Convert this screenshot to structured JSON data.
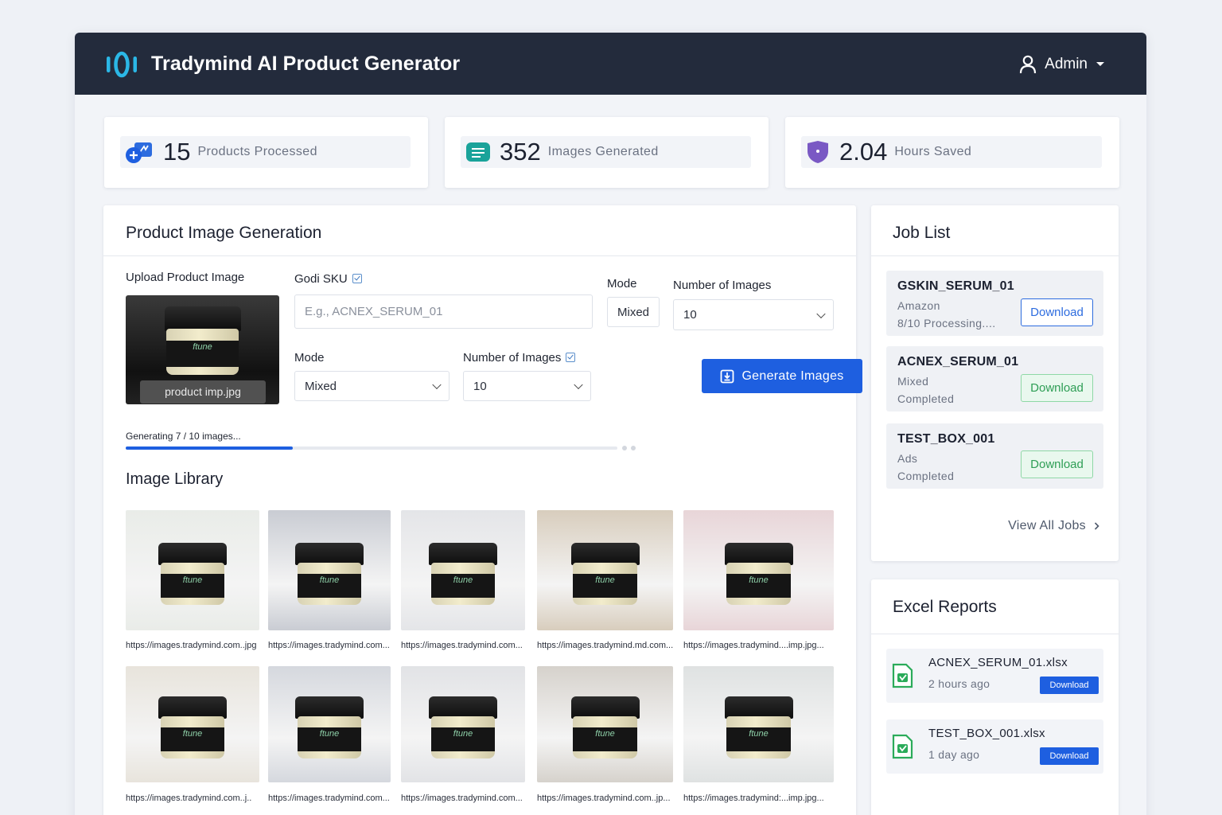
{
  "header": {
    "title": "Tradymind AI Product Generator",
    "user": "Admin"
  },
  "stats": [
    {
      "value": "15",
      "label": "Products Processed",
      "icon": "cloud-upload-icon"
    },
    {
      "value": "352",
      "label": "Images Generated",
      "icon": "images-stack-icon"
    },
    {
      "value": "2.04",
      "label": "Hours Saved",
      "icon": "shield-icon"
    }
  ],
  "generation": {
    "title": "Product Image Generation",
    "upload_label": "Upload Product Image",
    "upload_filename": "product imp.jpg",
    "sku_label": "Godi SKU",
    "sku_placeholder": "E.g., ACNEX_SERUM_01",
    "mode_label_top": "Mode",
    "mode_value_top": "Mixed",
    "num_label_top": "Number of Images",
    "num_value_top": "10",
    "mode_label": "Mode",
    "mode_value": "Mixed",
    "num_label": "Number of Images",
    "num_value": "10",
    "generate_button": "Generate Images",
    "progress_text": "Generating 7 / 10 images...",
    "progress_fraction": 0.34
  },
  "library": {
    "title": "Image Library",
    "images": [
      {
        "url": "https://images.tradymind.com..jpg",
        "bg": "#e9ece8"
      },
      {
        "url": "https://images.tradymind.com...",
        "bg": "#c9ccd3"
      },
      {
        "url": "https://images.tradymind.com...",
        "bg": "#e4e5e8"
      },
      {
        "url": "https://images.tradymind.md.com...",
        "bg": "#d8cdbd"
      },
      {
        "url": "https://images.tradymind....imp.jpg...",
        "bg": "#e8d5d8"
      },
      {
        "url": "https://images.tradymind.com..j..",
        "bg": "#e8e4dc"
      },
      {
        "url": "https://images.tradymind.com...",
        "bg": "#d5d8de"
      },
      {
        "url": "https://images.tradymind.com...",
        "bg": "#e2e3e6"
      },
      {
        "url": "https://images.tradymind.com..jp...",
        "bg": "#d6d2cc"
      },
      {
        "url": "https://images.tradymind:...imp.jpg...",
        "bg": "#dfe2e2"
      }
    ]
  },
  "jobs": {
    "title": "Job  List",
    "items": [
      {
        "sku": "GSKIN_SERUM_01",
        "line1": "Amazon",
        "line2": "8/10 Processing....",
        "action": "Download",
        "style": "blue"
      },
      {
        "sku": "ACNEX_SERUM_01",
        "line1": "Mixed",
        "line2": "Completed",
        "action": "Download",
        "style": "green"
      },
      {
        "sku": "TEST_BOX_001",
        "line1": "Ads",
        "line2": "Completed",
        "action": "Download",
        "style": "green"
      }
    ],
    "view_all": "View All Jobs"
  },
  "reports": {
    "title": "Excel Reports",
    "items": [
      {
        "name": "ACNEX_SERUM_01.xlsx",
        "time": "2 hours ago",
        "action": "Download"
      },
      {
        "name": "TEST_BOX_001.xlsx",
        "time": "1 day ago",
        "action": "Download"
      }
    ]
  },
  "colors": {
    "header": "#232b3c",
    "primary": "#1e5fe0",
    "accent_logo": "#2bb7e6",
    "success": "#2e9e55"
  }
}
